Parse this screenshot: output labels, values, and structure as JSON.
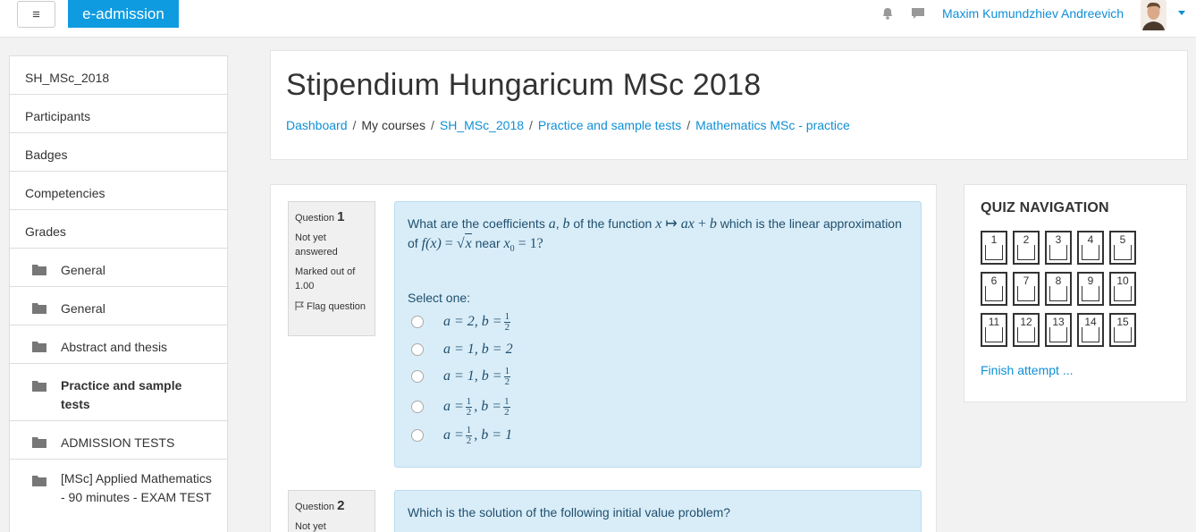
{
  "navbar": {
    "menu_glyph": "≡",
    "brand": "e-admission",
    "icons": [
      "bell-icon",
      "chat-icon"
    ],
    "user_name": "Maxim Kumundzhiev Andreevich"
  },
  "sidebar": {
    "items": [
      {
        "label": "SH_MSc_2018",
        "folder": false,
        "bold": false
      },
      {
        "label": "Participants",
        "folder": false,
        "bold": false
      },
      {
        "label": "Badges",
        "folder": false,
        "bold": false
      },
      {
        "label": "Competencies",
        "folder": false,
        "bold": false
      },
      {
        "label": "Grades",
        "folder": false,
        "bold": false
      },
      {
        "label": "General",
        "folder": true,
        "bold": false
      },
      {
        "label": "General",
        "folder": true,
        "bold": false
      },
      {
        "label": "Abstract and thesis",
        "folder": true,
        "bold": false
      },
      {
        "label": "Practice and sample tests",
        "folder": true,
        "bold": true
      },
      {
        "label": "ADMISSION TESTS",
        "folder": true,
        "bold": false
      },
      {
        "label": "[MSc] Applied Mathematics - 90 minutes - EXAM TEST",
        "folder": true,
        "bold": false
      }
    ]
  },
  "header": {
    "title": "Stipendium Hungaricum MSc 2018",
    "breadcrumb": [
      {
        "label": "Dashboard",
        "link": true
      },
      {
        "label": "My courses",
        "link": false
      },
      {
        "label": "SH_MSc_2018",
        "link": true
      },
      {
        "label": "Practice and sample tests",
        "link": true
      },
      {
        "label": "Mathematics MSc - practice",
        "link": true
      }
    ],
    "separator": "/"
  },
  "questions": [
    {
      "label": "Question",
      "number": "1",
      "state": "Not yet answered",
      "grade": "Marked out of 1.00",
      "flag": "Flag question",
      "text": {
        "p1": "What are the coefficients ",
        "v1": "a",
        "c1": ", ",
        "v2": "b",
        "p2": " of the function ",
        "v3": "x",
        "arrow": " ↦ ",
        "v4": "ax",
        "plus": " + ",
        "v5": "b",
        "p3": " which is the linear approximation of ",
        "v6": "f",
        "v7": "(x)",
        "eq": " = ",
        "sqrt": "√",
        "v8": "x",
        "p4": " near ",
        "v9": "x",
        "sub0": "0",
        "eq2": " = 1?"
      },
      "select_label": "Select one:",
      "answers": [
        {
          "a": "a = 2, b = ",
          "frac_num": "1",
          "frac_den": "2",
          "suffix": ""
        },
        {
          "a": "a = 1, b = 2",
          "frac_num": "",
          "frac_den": "",
          "suffix": ""
        },
        {
          "a": "a = 1, b = ",
          "frac_num": "1",
          "frac_den": "2",
          "suffix": ""
        },
        {
          "a": "a = ",
          "frac_num": "1",
          "frac_den": "2",
          "suffix": ", b = ",
          "frac2_num": "1",
          "frac2_den": "2"
        },
        {
          "a": "a = ",
          "frac_num": "1",
          "frac_den": "2",
          "suffix": ", b = 1"
        }
      ]
    },
    {
      "label": "Question",
      "number": "2",
      "state": "Not yet",
      "text": "Which is the solution of the following initial value problem?"
    }
  ],
  "quiz_nav": {
    "title": "QUIZ NAVIGATION",
    "buttons": [
      "1",
      "2",
      "3",
      "4",
      "5",
      "6",
      "7",
      "8",
      "9",
      "10",
      "11",
      "12",
      "13",
      "14",
      "15"
    ],
    "finish": "Finish attempt ..."
  }
}
